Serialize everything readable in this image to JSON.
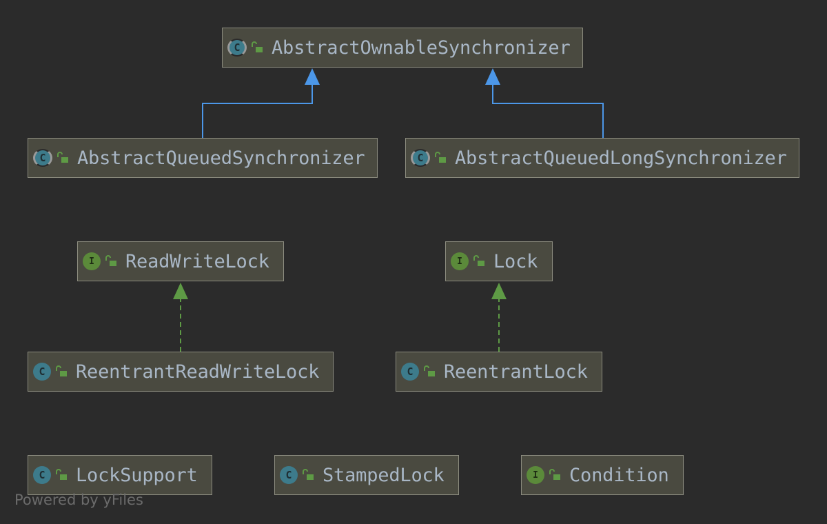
{
  "nodes": [
    {
      "id": "aos",
      "label": "AbstractOwnableSynchronizer",
      "kind": "abstract"
    },
    {
      "id": "aqs",
      "label": "AbstractQueuedSynchronizer",
      "kind": "abstract"
    },
    {
      "id": "aqls",
      "label": "AbstractQueuedLongSynchronizer",
      "kind": "abstract"
    },
    {
      "id": "rwl",
      "label": "ReadWriteLock",
      "kind": "interface"
    },
    {
      "id": "lock",
      "label": "Lock",
      "kind": "interface"
    },
    {
      "id": "rrwl",
      "label": "ReentrantReadWriteLock",
      "kind": "class"
    },
    {
      "id": "rl",
      "label": "ReentrantLock",
      "kind": "class"
    },
    {
      "id": "ls",
      "label": "LockSupport",
      "kind": "class"
    },
    {
      "id": "sl",
      "label": "StampedLock",
      "kind": "class"
    },
    {
      "id": "cond",
      "label": "Condition",
      "kind": "interface"
    }
  ],
  "edges": [
    {
      "from": "aqs",
      "to": "aos",
      "type": "extends"
    },
    {
      "from": "aqls",
      "to": "aos",
      "type": "extends"
    },
    {
      "from": "rrwl",
      "to": "rwl",
      "type": "implements"
    },
    {
      "from": "rl",
      "to": "lock",
      "type": "implements"
    }
  ],
  "icons": {
    "class_glyph": "C",
    "abstract_glyph": "C",
    "interface_glyph": "I",
    "visibility_icon": "lock-open-icon"
  },
  "colors": {
    "background": "#2b2b2b",
    "node_fill": "#4a4a40",
    "node_border": "#8c8c7f",
    "label_text": "#a9b7c6",
    "extends_edge": "#4c97e8",
    "implements_edge": "#5e9a45",
    "class_badge": "#3d7b8b",
    "interface_badge": "#5b8a3a"
  },
  "footer": "Powered by yFiles"
}
